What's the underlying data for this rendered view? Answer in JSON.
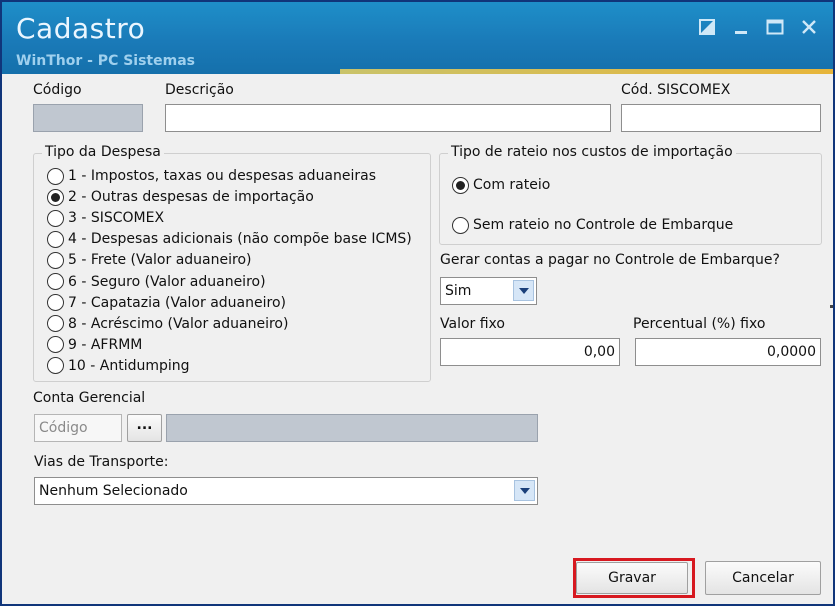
{
  "window": {
    "title": "Cadastro",
    "subtitle": "WinThor - PC Sistemas",
    "controls": [
      "restore-icon",
      "minimize-icon",
      "maximize-icon",
      "close-icon"
    ]
  },
  "fields": {
    "codigo_label": "Código",
    "codigo_value": "",
    "descricao_label": "Descrição",
    "descricao_value": "",
    "siscomex_label": "Cód. SISCOMEX",
    "siscomex_value": ""
  },
  "tipo_despesa": {
    "title": "Tipo da Despesa",
    "selected_index": 1,
    "options": [
      "1 - Impostos, taxas ou despesas aduaneiras",
      "2 - Outras despesas de importação",
      "3 - SISCOMEX",
      "4 - Despesas adicionais (não compõe base ICMS)",
      "5 - Frete (Valor aduaneiro)",
      "6 - Seguro (Valor aduaneiro)",
      "7 - Capatazia (Valor aduaneiro)",
      "8 - Acréscimo (Valor aduaneiro)",
      "9 - AFRMM",
      "10 - Antidumping"
    ]
  },
  "rateio": {
    "title": "Tipo de rateio nos custos de importação",
    "options": [
      "Com rateio",
      "Sem rateio no Controle de Embarque"
    ],
    "selected_index": 0
  },
  "gerar_contas": {
    "label": "Gerar contas a pagar no Controle de Embarque?",
    "selected": "Sim"
  },
  "valor_fixo": {
    "label": "Valor fixo",
    "value": "0,00"
  },
  "percentual_fixo": {
    "label": "Percentual (%) fixo",
    "value": "0,0000"
  },
  "conta_gerencial": {
    "label": "Conta Gerencial",
    "codigo_placeholder": "Código",
    "browse_label": "...",
    "descricao_value": ""
  },
  "vias_transporte": {
    "label": "Vias de Transporte:",
    "selected": "Nenhum Selecionado"
  },
  "buttons": {
    "gravar": "Gravar",
    "cancelar": "Cancelar"
  },
  "colors": {
    "titlebar": "#1a7ab8",
    "highlight": "#d71920",
    "disabled_field": "#c0c7d0"
  }
}
